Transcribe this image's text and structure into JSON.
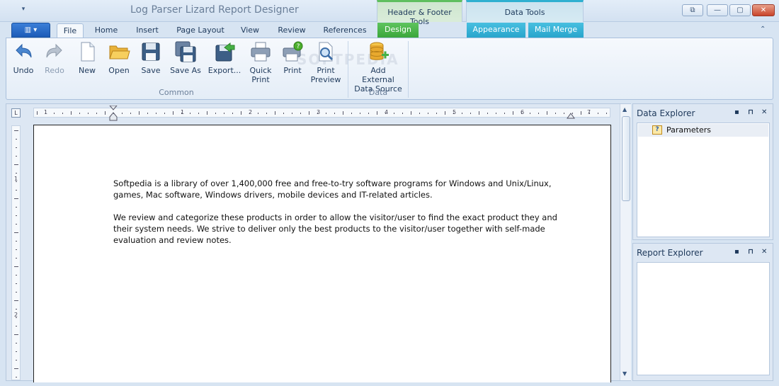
{
  "window": {
    "title": "Log Parser Lizard Report Designer",
    "qat_arrow": "▾",
    "controls": {
      "restore_special": "⧉",
      "minimize": "—",
      "maximize": "▢",
      "close": "✕"
    }
  },
  "context_groups": {
    "header_footer": "Header & Footer Tools",
    "data_tools": "Data Tools"
  },
  "tabs": {
    "app_menu": "▥ ▾",
    "file": "File",
    "home": "Home",
    "insert": "Insert",
    "page_layout": "Page Layout",
    "view": "View",
    "review": "Review",
    "references": "References",
    "design": "Design",
    "appearance": "Appearance",
    "mail_merge": "Mail Merge",
    "collapse": "⌃"
  },
  "ribbon": {
    "undo": "Undo",
    "redo": "Redo",
    "new": "New",
    "open": "Open",
    "save": "Save",
    "save_as": "Save As",
    "export": "Export...",
    "quick_print": "Quick Print",
    "print": "Print",
    "print_preview": "Print Preview",
    "add_external_data_source": "Add External Data Source",
    "group_common": "Common",
    "group_data": "Data"
  },
  "watermark": "SOFTPEDIA",
  "ruler": {
    "corner": "L",
    "h_numbers": [
      "1",
      "1",
      "2",
      "3",
      "4",
      "5",
      "6",
      "7"
    ],
    "v_numbers": [
      "1",
      "2"
    ]
  },
  "document": {
    "para1": "Softpedia is a library of over 1,400,000 free and free-to-try software programs for Windows and Unix/Linux, games, Mac software, Windows drivers, mobile devices and IT-related articles.",
    "para2": "We review and categorize these products in order to allow the visitor/user to find the exact product they and their system needs. We strive to deliver only the best products to the visitor/user together with self-made evaluation and review notes."
  },
  "scrollbar": {
    "up": "▲",
    "down": "▼"
  },
  "data_explorer": {
    "title": "Data Explorer",
    "item": "Parameters",
    "item_icon": "?",
    "pin": "⊓",
    "dock": "▪",
    "close": "✕"
  },
  "report_explorer": {
    "title": "Report Explorer",
    "pin": "⊓",
    "dock": "▪",
    "close": "✕"
  }
}
